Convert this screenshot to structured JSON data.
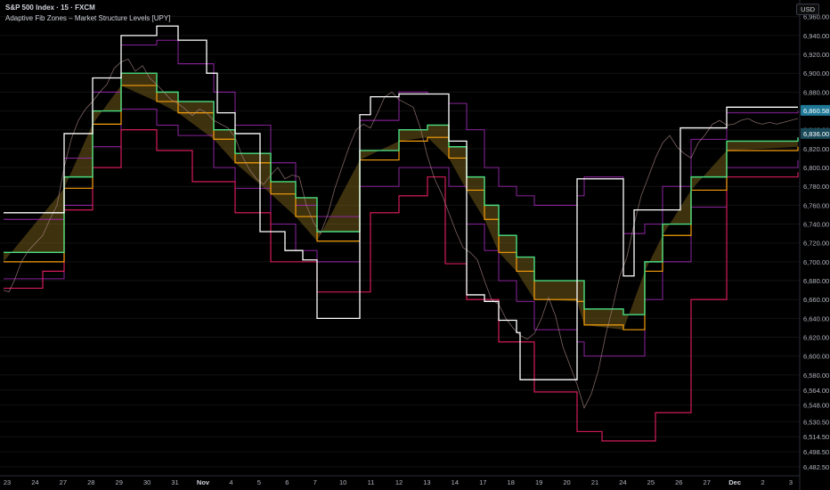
{
  "header": {
    "title": "S&P 500 Index · 15 · FXCM",
    "subtitle": "Adaptive Fib Zones – Market Structure Levels [UPY]",
    "currency": "USD"
  },
  "colors": {
    "background": "#000000",
    "structure_line": "#ffffff",
    "outer_band": "#e91e63",
    "inner_band": "#9c27b0",
    "fib_mid": "#2e7d5b",
    "fib_core": "#4ade80",
    "zone_fill": "#8a6d1f",
    "zone_edge": "#f59e0b",
    "bull_marker": "#22c55e",
    "bear_marker": "#ef4444",
    "blue_dot": "#4f6bed",
    "orange_dot": "#f97316",
    "price_label": "#1e7896",
    "price_label_alt": "#1a4a5a"
  },
  "chart_data": {
    "type": "line",
    "ylim": [
      6475,
      6972
    ],
    "y_ticks": [
      "6,960.00",
      "6,940.00",
      "6,920.00",
      "6,900.00",
      "6,880.00",
      "6,860.00",
      "6,840.00",
      "6,820.00",
      "6,800.00",
      "6,780.00",
      "6,760.00",
      "6,740.00",
      "6,720.00",
      "6,700.00",
      "6,680.00",
      "6,660.00",
      "6,640.00",
      "6,620.00",
      "6,600.00",
      "6,580.00",
      "6,564.00",
      "6,548.00",
      "6,530.50",
      "6,514.50",
      "6,498.50",
      "6,482.50"
    ],
    "x_labels": [
      "23",
      "24",
      "27",
      "28",
      "29",
      "30",
      "31",
      "Nov",
      "4",
      "5",
      "6",
      "7",
      "10",
      "11",
      "12",
      "13",
      "14",
      "17",
      "18",
      "19",
      "20",
      "21",
      "24",
      "25",
      "26",
      "27",
      "Dec",
      "2",
      "3"
    ],
    "x_strong": [
      "Nov",
      "Dec"
    ],
    "price_labels": [
      {
        "text": "6,860.58",
        "value": 6860.58,
        "kind": "main"
      },
      {
        "text": "6,836.00",
        "value": 6836,
        "kind": "alt"
      }
    ],
    "series": [
      {
        "name": "",
        "role": "price",
        "x": [
          0,
          6,
          12,
          20,
          28,
          36,
          44,
          52,
          60,
          68,
          76,
          84,
          92,
          100,
          108,
          116,
          124,
          132,
          140,
          148,
          156,
          164,
          172,
          180,
          188,
          196,
          204,
          212,
          220,
          228,
          236,
          244,
          252,
          260,
          268,
          276,
          284,
          292,
          300,
          308,
          316,
          324,
          332,
          340,
          348,
          356,
          364,
          372,
          380,
          388,
          396,
          404,
          412,
          420,
          428,
          436,
          444,
          452,
          460,
          468,
          476,
          484,
          492,
          500,
          508,
          516,
          524,
          532,
          540,
          548,
          556,
          564,
          572,
          580,
          588,
          596,
          604,
          612,
          620,
          628,
          636,
          644,
          652,
          660,
          668,
          676,
          684,
          692,
          700,
          708,
          716,
          724,
          732,
          740,
          748,
          756,
          764,
          772,
          780,
          788,
          796,
          804,
          812,
          820,
          828,
          836,
          844,
          852,
          860,
          868,
          876,
          884,
          892
        ],
        "y": [
          6670,
          6668,
          6680,
          6700,
          6712,
          6720,
          6728,
          6745,
          6760,
          6800,
          6830,
          6850,
          6862,
          6870,
          6880,
          6888,
          6905,
          6912,
          6915,
          6902,
          6908,
          6895,
          6888,
          6880,
          6872,
          6868,
          6862,
          6855,
          6862,
          6858,
          6850,
          6846,
          6842,
          6832,
          6812,
          6798,
          6788,
          6782,
          6792,
          6800,
          6788,
          6792,
          6790,
          6760,
          6742,
          6730,
          6750,
          6778,
          6800,
          6822,
          6840,
          6846,
          6842,
          6858,
          6875,
          6880,
          6872,
          6868,
          6864,
          6842,
          6812,
          6788,
          6772,
          6752,
          6732,
          6715,
          6710,
          6702,
          6680,
          6660,
          6655,
          6640,
          6630,
          6622,
          6618,
          6624,
          6640,
          6662,
          6642,
          6610,
          6590,
          6570,
          6545,
          6560,
          6585,
          6622,
          6652,
          6685,
          6705,
          6740,
          6770,
          6790,
          6810,
          6826,
          6834,
          6822,
          6815,
          6810,
          6826,
          6835,
          6846,
          6850,
          6845,
          6846,
          6850,
          6852,
          6848,
          6846,
          6848,
          6846,
          6848,
          6850,
          6852
        ]
      },
      {
        "name": "",
        "role": "structure",
        "step": true,
        "x": [
          0,
          68,
          100,
          132,
          172,
          196,
          228,
          240,
          260,
          288,
          300,
          316,
          336,
          352,
          368,
          400,
          412,
          444,
          476,
          500,
          520,
          540,
          556,
          576,
          580,
          596,
          644,
          648,
          696,
          700,
          708,
          760,
          772,
          812,
          816,
          892
        ],
        "y": [
          6752,
          6836,
          6895,
          6940,
          6950,
          6935,
          6900,
          6858,
          6836,
          6732,
          6732,
          6712,
          6702,
          6640,
          6640,
          6856,
          6875,
          6878,
          6878,
          6828,
          6665,
          6658,
          6638,
          6625,
          6575,
          6575,
          6788,
          6788,
          6685,
          6685,
          6755,
          6842,
          6842,
          6864,
          6864,
          6864
        ]
      },
      {
        "name": "",
        "role": "outer-top",
        "step": true,
        "x": [
          0,
          68,
          100,
          132,
          172,
          196,
          236,
          260,
          300,
          328,
          352,
          400,
          444,
          476,
          500,
          520,
          540,
          556,
          576,
          596,
          644,
          652,
          696,
          720,
          740,
          772,
          812,
          892
        ],
        "y": [
          6745,
          6810,
          6880,
          6930,
          6935,
          6910,
          6880,
          6845,
          6805,
          6760,
          6748,
          6850,
          6880,
          6878,
          6868,
          6840,
          6800,
          6780,
          6770,
          6760,
          6770,
          6790,
          6730,
          6740,
          6780,
          6830,
          6858,
          6860
        ]
      },
      {
        "name": "",
        "role": "core-top",
        "step": true,
        "x": [
          0,
          68,
          100,
          132,
          172,
          196,
          236,
          260,
          300,
          328,
          352,
          400,
          444,
          476,
          500,
          520,
          540,
          556,
          576,
          596,
          644,
          652,
          696,
          720,
          740,
          772,
          812,
          892
        ],
        "y": [
          6710,
          6790,
          6860,
          6900,
          6880,
          6870,
          6840,
          6815,
          6785,
          6768,
          6732,
          6818,
          6840,
          6845,
          6822,
          6790,
          6760,
          6728,
          6705,
          6680,
          6680,
          6650,
          6644,
          6700,
          6740,
          6790,
          6828,
          6832
        ]
      },
      {
        "name": "",
        "role": "core-bottom",
        "step": true,
        "x": [
          0,
          68,
          100,
          132,
          172,
          196,
          236,
          260,
          300,
          328,
          352,
          400,
          444,
          476,
          500,
          520,
          540,
          556,
          576,
          596,
          644,
          652,
          696,
          720,
          740,
          772,
          812,
          892
        ],
        "y": [
          6700,
          6778,
          6846,
          6887,
          6870,
          6858,
          6830,
          6805,
          6772,
          6748,
          6722,
          6808,
          6828,
          6832,
          6810,
          6776,
          6745,
          6710,
          6690,
          6660,
          6658,
          6633,
          6628,
          6690,
          6728,
          6776,
          6818,
          6822
        ]
      },
      {
        "name": "",
        "role": "outer-bottom",
        "step": true,
        "x": [
          0,
          68,
          100,
          132,
          172,
          196,
          236,
          260,
          300,
          328,
          352,
          400,
          444,
          476,
          500,
          520,
          540,
          556,
          576,
          596,
          644,
          652,
          696,
          720,
          740,
          772,
          812,
          892
        ],
        "y": [
          6682,
          6760,
          6822,
          6862,
          6845,
          6834,
          6800,
          6778,
          6740,
          6712,
          6700,
          6780,
          6800,
          6800,
          6780,
          6740,
          6712,
          6680,
          6658,
          6628,
          6615,
          6600,
          6600,
          6660,
          6700,
          6758,
          6800,
          6808
        ]
      },
      {
        "name": "",
        "role": "floor",
        "step": true,
        "x": [
          0,
          44,
          68,
          100,
          132,
          172,
          212,
          260,
          300,
          352,
          412,
          444,
          476,
          496,
          520,
          556,
          596,
          644,
          672,
          732,
          772,
          812,
          892
        ],
        "y": [
          6672,
          6690,
          6755,
          6800,
          6840,
          6818,
          6785,
          6752,
          6700,
          6668,
          6752,
          6770,
          6790,
          6698,
          6660,
          6615,
          6562,
          6520,
          6510,
          6540,
          6660,
          6790,
          6795
        ]
      }
    ]
  }
}
